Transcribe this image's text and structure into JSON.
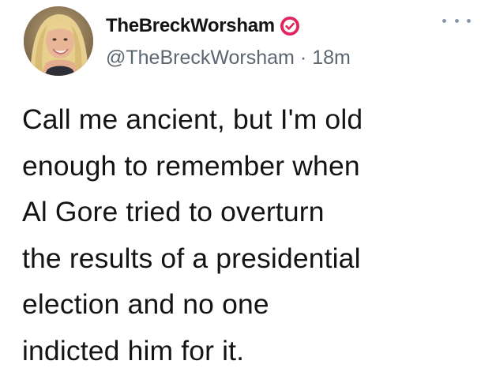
{
  "tweet": {
    "author": {
      "display_name": "TheBreckWorsham",
      "handle": "@TheBreckWorsham",
      "verified": true,
      "avatar_icon": "profile-photo",
      "verified_icon": "verified-badge-icon",
      "verified_color": "#e0245e"
    },
    "separator": "·",
    "timestamp": "18m",
    "more_icon": "more-options-icon",
    "body_lines": [
      "Call me ancient, but I'm old",
      "enough to remember when",
      "Al Gore tried to overturn",
      "the results of a presidential",
      "election and no one",
      "indicted him for it."
    ]
  }
}
